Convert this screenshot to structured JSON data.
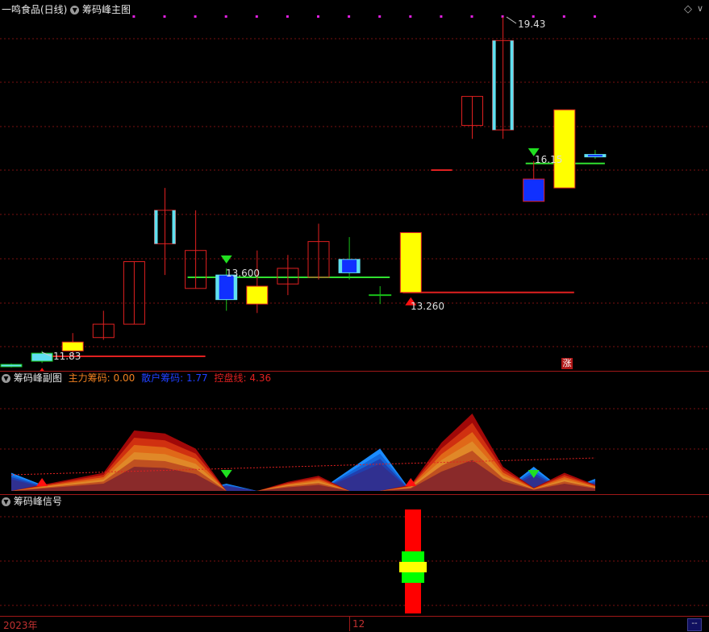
{
  "main": {
    "stock": "一鸣食品(日线)",
    "indicator": "筹码峰主图",
    "diamond": "◇",
    "labels": {
      "high": "19.43",
      "low": "11.83",
      "p1": "13.600",
      "p2": "13.260",
      "p3": "16.15"
    },
    "rise_badge": "涨"
  },
  "sub": {
    "indicator": "筹码峰副图",
    "main_chips_label": "主力筹码:",
    "main_chips_value": "0.00",
    "retail_chips_label": "散户筹码:",
    "retail_chips_value": "1.77",
    "control_label": "控盘线:",
    "control_value": "4.36"
  },
  "signal": {
    "indicator": "筹码峰信号"
  },
  "axis": {
    "year": "2023年",
    "month": "12",
    "corner": "--"
  },
  "colors": {
    "up": "#e02020",
    "down": "#18c018",
    "cyan": "#60e0f0",
    "blue": "#1030ff",
    "yellow": "#ffff00"
  },
  "chart_data": {
    "type": "candlestick",
    "y_min_label": "11.83",
    "y_max_label": "19.43",
    "candles": [
      {
        "o": 11.6,
        "c": 11.65,
        "h": 11.67,
        "l": 11.58,
        "kind": "greenbar"
      },
      {
        "o": 11.72,
        "c": 11.9,
        "h": 11.95,
        "l": 11.68,
        "kind": "greenbar"
      },
      {
        "o": 11.95,
        "c": 12.15,
        "h": 12.35,
        "l": 11.85,
        "kind": "yellow"
      },
      {
        "o": 12.25,
        "c": 12.55,
        "h": 12.85,
        "l": 12.2,
        "kind": "red"
      },
      {
        "o": 12.55,
        "c": 13.95,
        "h": 13.95,
        "l": 12.55,
        "kind": "red"
      },
      {
        "o": 14.35,
        "c": 15.1,
        "h": 15.6,
        "l": 13.65,
        "kind": "cyan"
      },
      {
        "o": 13.35,
        "c": 14.2,
        "h": 15.1,
        "l": 13.35,
        "kind": "red"
      },
      {
        "o": 13.1,
        "c": 13.65,
        "h": 13.8,
        "l": 12.85,
        "kind": "bluecyan"
      },
      {
        "o": 13.0,
        "c": 13.4,
        "h": 14.2,
        "l": 12.8,
        "kind": "yellow"
      },
      {
        "o": 13.45,
        "c": 13.8,
        "h": 14.1,
        "l": 13.2,
        "kind": "red"
      },
      {
        "o": 13.6,
        "c": 14.4,
        "h": 14.8,
        "l": 13.55,
        "kind": "red"
      },
      {
        "o": 13.7,
        "c": 14.0,
        "h": 14.5,
        "l": 13.55,
        "kind": "bluecyan"
      },
      {
        "o": 13.2,
        "c": 13.2,
        "h": 13.4,
        "l": 13.0,
        "kind": "greencross"
      },
      {
        "o": 13.26,
        "c": 14.6,
        "h": 14.6,
        "l": 13.26,
        "kind": "yellow"
      },
      {
        "o": 16.0,
        "c": 16.0,
        "h": 16.0,
        "l": 16.0,
        "kind": "redflat"
      },
      {
        "o": 17.0,
        "c": 17.65,
        "h": 17.65,
        "l": 16.7,
        "kind": "red"
      },
      {
        "o": 16.9,
        "c": 18.9,
        "h": 19.43,
        "l": 16.7,
        "kind": "cyan"
      },
      {
        "o": 15.3,
        "c": 15.8,
        "h": 16.2,
        "l": 15.3,
        "kind": "blue"
      },
      {
        "o": 15.6,
        "c": 17.35,
        "h": 17.35,
        "l": 15.6,
        "kind": "yellow"
      },
      {
        "o": 16.35,
        "c": 16.35,
        "h": 16.45,
        "l": 16.25,
        "kind": "bluecyan"
      }
    ],
    "support_lines": [
      {
        "from": 1,
        "to": 6,
        "y": 11.83,
        "color": "red"
      },
      {
        "from": 6,
        "to": 12,
        "y": 13.6,
        "color": "green"
      },
      {
        "from": 13,
        "to": 18,
        "y": 13.26,
        "color": "red"
      },
      {
        "from": 17,
        "to": 19,
        "y": 16.15,
        "color": "green"
      }
    ],
    "markers": [
      {
        "i": 1,
        "dir": "up"
      },
      {
        "i": 7,
        "dir": "down"
      },
      {
        "i": 13,
        "dir": "up"
      },
      {
        "i": 17,
        "dir": "down"
      }
    ],
    "top_dots_count": 16,
    "sub_chart": {
      "main_chips_peaks": [
        {
          "i": 0,
          "v": 0
        },
        {
          "i": 3,
          "v": 0.3
        },
        {
          "i": 4,
          "v": 1.0
        },
        {
          "i": 5,
          "v": 0.95
        },
        {
          "i": 6,
          "v": 0.7
        },
        {
          "i": 7,
          "v": 0
        },
        {
          "i": 8,
          "v": 0
        },
        {
          "i": 9,
          "v": 0.15
        },
        {
          "i": 10,
          "v": 0.25
        },
        {
          "i": 11,
          "v": 0
        },
        {
          "i": 12,
          "v": 0
        },
        {
          "i": 13,
          "v": 0.1
        },
        {
          "i": 14,
          "v": 0.8
        },
        {
          "i": 15,
          "v": 1.28
        },
        {
          "i": 16,
          "v": 0.4
        },
        {
          "i": 17,
          "v": 0.05
        },
        {
          "i": 18,
          "v": 0.3
        },
        {
          "i": 19,
          "v": 0.1
        }
      ],
      "retail_chips_peaks": [
        {
          "i": 0,
          "v": 0.3
        },
        {
          "i": 1,
          "v": 0.1
        },
        {
          "i": 2,
          "v": 0
        },
        {
          "i": 6,
          "v": 0
        },
        {
          "i": 7,
          "v": 0.12
        },
        {
          "i": 8,
          "v": 0
        },
        {
          "i": 10,
          "v": 0
        },
        {
          "i": 12,
          "v": 0.7
        },
        {
          "i": 13,
          "v": 0
        },
        {
          "i": 16,
          "v": 0
        },
        {
          "i": 17,
          "v": 0.4
        },
        {
          "i": 18,
          "v": 0
        },
        {
          "i": 19,
          "v": 0.2
        }
      ]
    }
  }
}
